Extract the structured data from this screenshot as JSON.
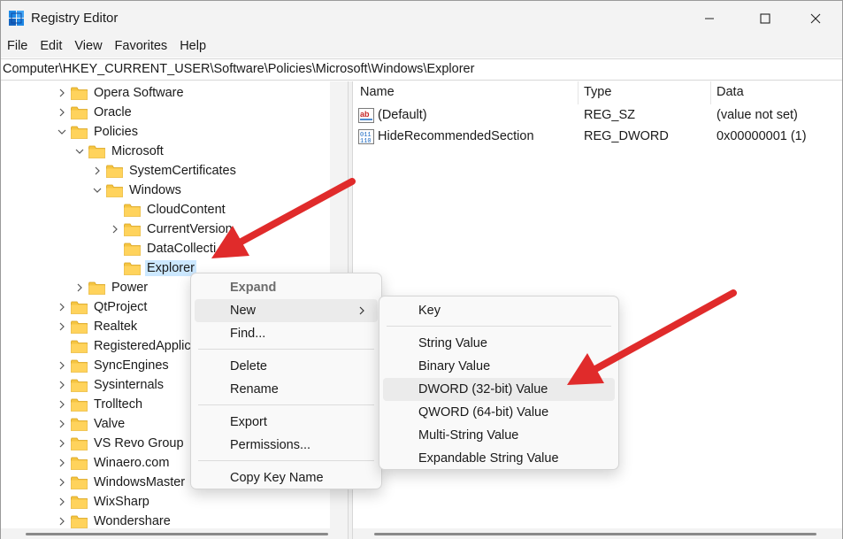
{
  "window": {
    "title": "Registry Editor",
    "minimize_label": "Minimize",
    "maximize_label": "Maximize",
    "close_label": "Close"
  },
  "menu": [
    "File",
    "Edit",
    "View",
    "Favorites",
    "Help"
  ],
  "address": {
    "path": "Computer\\HKEY_CURRENT_USER\\Software\\Policies\\Microsoft\\Windows\\Explorer"
  },
  "tree": [
    {
      "label": "Opera Software",
      "level": 0,
      "expander": "collapsed"
    },
    {
      "label": "Oracle",
      "level": 0,
      "expander": "collapsed"
    },
    {
      "label": "Policies",
      "level": 0,
      "expander": "expanded"
    },
    {
      "label": "Microsoft",
      "level": 1,
      "expander": "expanded"
    },
    {
      "label": "SystemCertificates",
      "level": 2,
      "expander": "collapsed"
    },
    {
      "label": "Windows",
      "level": 2,
      "expander": "expanded"
    },
    {
      "label": "CloudContent",
      "level": 3,
      "expander": "none"
    },
    {
      "label": "CurrentVersion",
      "level": 3,
      "expander": "collapsed"
    },
    {
      "label": "DataCollecti",
      "level": 3,
      "expander": "none"
    },
    {
      "label": "Explorer",
      "level": 3,
      "expander": "none",
      "selected": true
    },
    {
      "label": "Power",
      "level": 1,
      "expander": "collapsed"
    },
    {
      "label": "QtProject",
      "level": 0,
      "expander": "collapsed"
    },
    {
      "label": "Realtek",
      "level": 0,
      "expander": "collapsed"
    },
    {
      "label": "RegisteredApplic",
      "level": 0,
      "expander": "none"
    },
    {
      "label": "SyncEngines",
      "level": 0,
      "expander": "collapsed"
    },
    {
      "label": "Sysinternals",
      "level": 0,
      "expander": "collapsed"
    },
    {
      "label": "Trolltech",
      "level": 0,
      "expander": "collapsed"
    },
    {
      "label": "Valve",
      "level": 0,
      "expander": "collapsed"
    },
    {
      "label": "VS Revo Group",
      "level": 0,
      "expander": "collapsed"
    },
    {
      "label": "Winaero.com",
      "level": 0,
      "expander": "collapsed"
    },
    {
      "label": "WindowsMaster",
      "level": 0,
      "expander": "collapsed"
    },
    {
      "label": "WixSharp",
      "level": 0,
      "expander": "collapsed"
    },
    {
      "label": "Wondershare",
      "level": 0,
      "expander": "collapsed"
    }
  ],
  "values_table": {
    "columns": [
      "Name",
      "Type",
      "Data"
    ],
    "rows": [
      {
        "icon": "string-value-icon",
        "name": "(Default)",
        "type": "REG_SZ",
        "data": "(value not set)"
      },
      {
        "icon": "dword-value-icon",
        "name": "HideRecommendedSection",
        "type": "REG_DWORD",
        "data": "0x00000001 (1)"
      }
    ]
  },
  "context_menu": {
    "items": [
      {
        "label": "Expand",
        "disabled": true
      },
      {
        "label": "New",
        "submenu": true,
        "highlighted": true
      },
      {
        "label": "Find..."
      },
      {
        "separator": true
      },
      {
        "label": "Delete"
      },
      {
        "label": "Rename"
      },
      {
        "separator": true
      },
      {
        "label": "Export"
      },
      {
        "label": "Permissions..."
      },
      {
        "separator": true
      },
      {
        "label": "Copy Key Name"
      }
    ]
  },
  "new_submenu": {
    "items": [
      {
        "label": "Key"
      },
      {
        "separator": true
      },
      {
        "label": "String Value"
      },
      {
        "label": "Binary Value"
      },
      {
        "label": "DWORD (32-bit) Value",
        "highlighted": true
      },
      {
        "label": "QWORD (64-bit) Value"
      },
      {
        "label": "Multi-String Value"
      },
      {
        "label": "Expandable String Value"
      }
    ]
  },
  "colors": {
    "annotation_arrow": "#e02b2b",
    "folder": "#f5c542",
    "selection": "#cce8ff"
  }
}
